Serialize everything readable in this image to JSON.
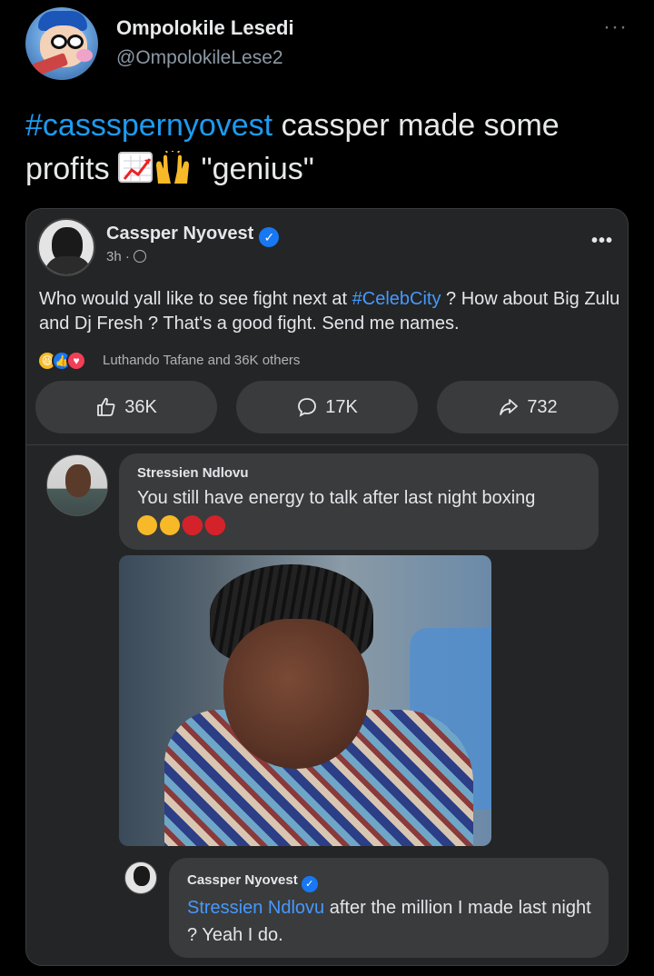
{
  "tweet": {
    "author_name": "Ompolokile Lesedi",
    "author_handle": "@OmpolokileLese2",
    "more_label": "···",
    "hashtag": "#cassspernyovest",
    "text_after_hashtag": " cassper made some",
    "text_line2_start": "profits ",
    "text_line2_end": " \"genius\"",
    "emojis": [
      "chart-increasing-icon",
      "raising-hands-icon"
    ]
  },
  "fb_post": {
    "author_name": "Cassper Nyovest",
    "time": "3h ·",
    "more_label": "•••",
    "text_before_tag": "Who would yall like to see fight next at ",
    "tag": "#CelebCity",
    "text_after_tag": " ? How about Big Zulu and Dj Fresh ? That's a good fight. Send me names.",
    "reactions_text": "Luthando Tafane and 36K others",
    "like_count": "36K",
    "comment_count": "17K",
    "share_count": "732"
  },
  "comments": [
    {
      "author": "Stressien Ndlovu",
      "text": "You still have energy to talk after last night boxing"
    },
    {
      "author": "Cassper Nyovest",
      "mention": "Stressien Ndlovu",
      "text": " after the million I made last night ? Yeah I do."
    }
  ],
  "colors": {
    "background": "#000000",
    "hashtag_blue": "#1d9bf0",
    "fb_card": "#242526",
    "fb_bubble": "#3a3b3c",
    "fb_link": "#4599ff"
  }
}
